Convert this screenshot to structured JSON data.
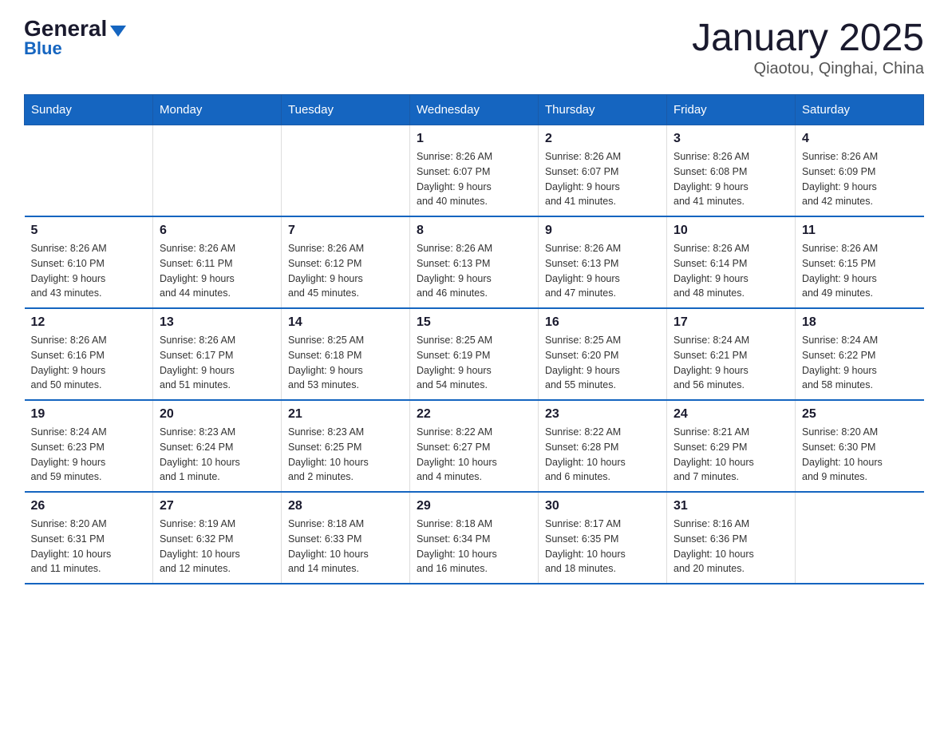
{
  "header": {
    "logo_general": "General",
    "logo_blue": "Blue",
    "title": "January 2025",
    "subtitle": "Qiaotou, Qinghai, China"
  },
  "days_of_week": [
    "Sunday",
    "Monday",
    "Tuesday",
    "Wednesday",
    "Thursday",
    "Friday",
    "Saturday"
  ],
  "weeks": [
    [
      {
        "day": "",
        "info": ""
      },
      {
        "day": "",
        "info": ""
      },
      {
        "day": "",
        "info": ""
      },
      {
        "day": "1",
        "info": "Sunrise: 8:26 AM\nSunset: 6:07 PM\nDaylight: 9 hours\nand 40 minutes."
      },
      {
        "day": "2",
        "info": "Sunrise: 8:26 AM\nSunset: 6:07 PM\nDaylight: 9 hours\nand 41 minutes."
      },
      {
        "day": "3",
        "info": "Sunrise: 8:26 AM\nSunset: 6:08 PM\nDaylight: 9 hours\nand 41 minutes."
      },
      {
        "day": "4",
        "info": "Sunrise: 8:26 AM\nSunset: 6:09 PM\nDaylight: 9 hours\nand 42 minutes."
      }
    ],
    [
      {
        "day": "5",
        "info": "Sunrise: 8:26 AM\nSunset: 6:10 PM\nDaylight: 9 hours\nand 43 minutes."
      },
      {
        "day": "6",
        "info": "Sunrise: 8:26 AM\nSunset: 6:11 PM\nDaylight: 9 hours\nand 44 minutes."
      },
      {
        "day": "7",
        "info": "Sunrise: 8:26 AM\nSunset: 6:12 PM\nDaylight: 9 hours\nand 45 minutes."
      },
      {
        "day": "8",
        "info": "Sunrise: 8:26 AM\nSunset: 6:13 PM\nDaylight: 9 hours\nand 46 minutes."
      },
      {
        "day": "9",
        "info": "Sunrise: 8:26 AM\nSunset: 6:13 PM\nDaylight: 9 hours\nand 47 minutes."
      },
      {
        "day": "10",
        "info": "Sunrise: 8:26 AM\nSunset: 6:14 PM\nDaylight: 9 hours\nand 48 minutes."
      },
      {
        "day": "11",
        "info": "Sunrise: 8:26 AM\nSunset: 6:15 PM\nDaylight: 9 hours\nand 49 minutes."
      }
    ],
    [
      {
        "day": "12",
        "info": "Sunrise: 8:26 AM\nSunset: 6:16 PM\nDaylight: 9 hours\nand 50 minutes."
      },
      {
        "day": "13",
        "info": "Sunrise: 8:26 AM\nSunset: 6:17 PM\nDaylight: 9 hours\nand 51 minutes."
      },
      {
        "day": "14",
        "info": "Sunrise: 8:25 AM\nSunset: 6:18 PM\nDaylight: 9 hours\nand 53 minutes."
      },
      {
        "day": "15",
        "info": "Sunrise: 8:25 AM\nSunset: 6:19 PM\nDaylight: 9 hours\nand 54 minutes."
      },
      {
        "day": "16",
        "info": "Sunrise: 8:25 AM\nSunset: 6:20 PM\nDaylight: 9 hours\nand 55 minutes."
      },
      {
        "day": "17",
        "info": "Sunrise: 8:24 AM\nSunset: 6:21 PM\nDaylight: 9 hours\nand 56 minutes."
      },
      {
        "day": "18",
        "info": "Sunrise: 8:24 AM\nSunset: 6:22 PM\nDaylight: 9 hours\nand 58 minutes."
      }
    ],
    [
      {
        "day": "19",
        "info": "Sunrise: 8:24 AM\nSunset: 6:23 PM\nDaylight: 9 hours\nand 59 minutes."
      },
      {
        "day": "20",
        "info": "Sunrise: 8:23 AM\nSunset: 6:24 PM\nDaylight: 10 hours\nand 1 minute."
      },
      {
        "day": "21",
        "info": "Sunrise: 8:23 AM\nSunset: 6:25 PM\nDaylight: 10 hours\nand 2 minutes."
      },
      {
        "day": "22",
        "info": "Sunrise: 8:22 AM\nSunset: 6:27 PM\nDaylight: 10 hours\nand 4 minutes."
      },
      {
        "day": "23",
        "info": "Sunrise: 8:22 AM\nSunset: 6:28 PM\nDaylight: 10 hours\nand 6 minutes."
      },
      {
        "day": "24",
        "info": "Sunrise: 8:21 AM\nSunset: 6:29 PM\nDaylight: 10 hours\nand 7 minutes."
      },
      {
        "day": "25",
        "info": "Sunrise: 8:20 AM\nSunset: 6:30 PM\nDaylight: 10 hours\nand 9 minutes."
      }
    ],
    [
      {
        "day": "26",
        "info": "Sunrise: 8:20 AM\nSunset: 6:31 PM\nDaylight: 10 hours\nand 11 minutes."
      },
      {
        "day": "27",
        "info": "Sunrise: 8:19 AM\nSunset: 6:32 PM\nDaylight: 10 hours\nand 12 minutes."
      },
      {
        "day": "28",
        "info": "Sunrise: 8:18 AM\nSunset: 6:33 PM\nDaylight: 10 hours\nand 14 minutes."
      },
      {
        "day": "29",
        "info": "Sunrise: 8:18 AM\nSunset: 6:34 PM\nDaylight: 10 hours\nand 16 minutes."
      },
      {
        "day": "30",
        "info": "Sunrise: 8:17 AM\nSunset: 6:35 PM\nDaylight: 10 hours\nand 18 minutes."
      },
      {
        "day": "31",
        "info": "Sunrise: 8:16 AM\nSunset: 6:36 PM\nDaylight: 10 hours\nand 20 minutes."
      },
      {
        "day": "",
        "info": ""
      }
    ]
  ]
}
